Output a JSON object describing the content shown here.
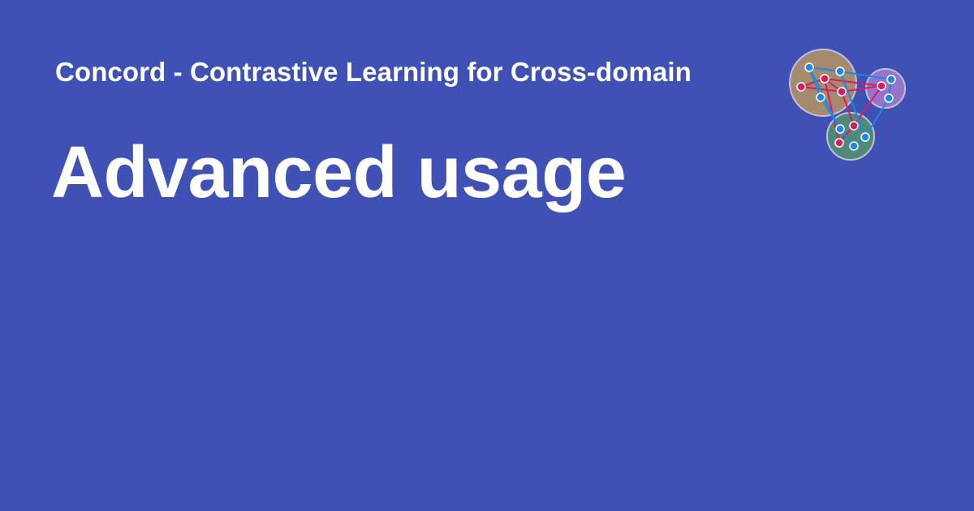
{
  "site": {
    "name": "Concord - Contrastive Learning for Cross-domain"
  },
  "page": {
    "title": "Advanced usage"
  },
  "logo": {
    "icon": "network-clusters-icon"
  },
  "colors": {
    "background": "#3f51b5",
    "text": "#ffffff",
    "cluster_brown": "#a58a6e",
    "cluster_purple": "#9575c9",
    "cluster_green": "#4f8a78",
    "node_red": "#d81b60",
    "node_blue": "#1e88e5"
  }
}
